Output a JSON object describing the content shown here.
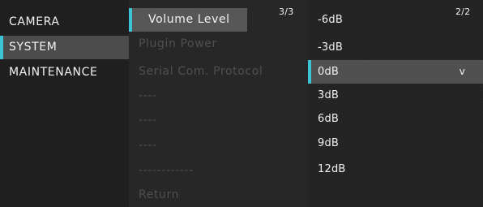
{
  "main_menu": {
    "items": [
      {
        "label": "CAMERA"
      },
      {
        "label": "SYSTEM"
      },
      {
        "label": "MAINTENANCE"
      }
    ]
  },
  "sub_menu": {
    "page": "3/3",
    "items": [
      {
        "label": "Volume Level"
      },
      {
        "label": "Plugin Power"
      },
      {
        "label": "Serial Com. Protocol"
      },
      {
        "label": "----"
      },
      {
        "label": "----"
      },
      {
        "label": "----"
      },
      {
        "label": "------------"
      },
      {
        "label": "Return"
      }
    ]
  },
  "value_list": {
    "page": "2/2",
    "selected_mark": "v",
    "items": [
      {
        "label": "-6dB"
      },
      {
        "label": "-3dB"
      },
      {
        "label": "0dB"
      },
      {
        "label": "3dB"
      },
      {
        "label": "6dB"
      },
      {
        "label": "9dB"
      },
      {
        "label": "12dB"
      }
    ]
  },
  "colors": {
    "accent": "#3cc3d6",
    "highlight": "#575757",
    "disabled_text": "#4f4f4f",
    "text": "#f2f2f2"
  }
}
